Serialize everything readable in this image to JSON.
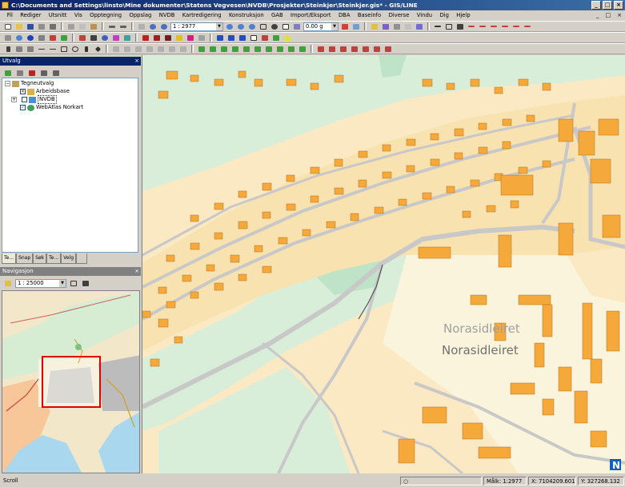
{
  "window": {
    "title": "C:\\Documents and Settings\\linsto\\Mine dokumenter\\Statens Vegvesen\\NVDB\\Prosjekter\\Steinkjer\\Steinkjer.gis* - GIS/LINE",
    "buttons": [
      "_",
      "□",
      "×"
    ]
  },
  "menu": {
    "items": [
      "Fil",
      "Rediger",
      "Utsnitt",
      "Vis",
      "Opptegning",
      "Oppslag",
      "NVDB",
      "Kartredigering",
      "Konstruksjon",
      "GAB",
      "Import/Eksport",
      "DBA",
      "Baseinfo",
      "Diverse",
      "Vindu",
      "Dig",
      "Hjelp"
    ],
    "right_controls": [
      "_",
      "□",
      "×"
    ]
  },
  "toolbar": {
    "scale_value": "1 : 2977",
    "rotation_value": "0.00 g"
  },
  "utvalg": {
    "title": "Utvalg",
    "close": "×",
    "tree": [
      {
        "label": "Tegneutvalg",
        "level": 0
      },
      {
        "label": "Arbeidsbase",
        "level": 1
      },
      {
        "label": "NVDB",
        "level": 1
      },
      {
        "label": "WebAtlas Norkart",
        "level": 1
      }
    ],
    "tabs": [
      "Te...",
      "Snap",
      "Søk",
      "Te...",
      "Velg",
      ""
    ]
  },
  "navigasjon": {
    "title": "Navigasjon",
    "close": "×",
    "scale_value": "1 : 25000"
  },
  "map": {
    "place_label": "Norasidleiret",
    "place_label_shadow": "Norasidleiret",
    "north_arrow": "N",
    "colors": {
      "background": "#fbe9c3",
      "building": "#f5a93a",
      "building_border": "#b07020",
      "road": "#c8c8c8",
      "forest": "#d8eed8",
      "park": "#bfe3c6",
      "dark_green": "#7fc47f",
      "field": "#fbf4dc"
    }
  },
  "statusbar": {
    "mode": "Scroll",
    "matk_label": "Målk:",
    "matk_value": "1:2977",
    "x_label": "X:",
    "x_value": "7104209.601",
    "y_label": "Y:",
    "y_value": "327268.132"
  }
}
